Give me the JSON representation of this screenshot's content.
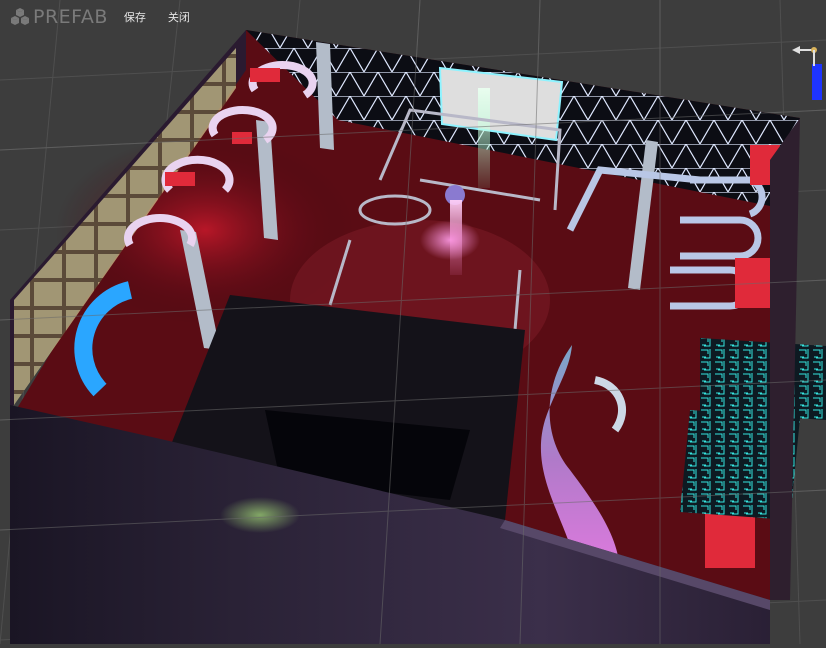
{
  "app": {
    "logo_text": "PREFAB",
    "logo_icon": "cubes-icon"
  },
  "toolbar": {
    "save_label": "保存",
    "close_label": "关闭"
  },
  "viewport": {
    "scene": "3d-nightclub-model",
    "background_color": "#3d3d3d",
    "grid_color": "#4a4a4a",
    "accent_colors": {
      "wall_lights": "#e6f0ff",
      "stair_glow": "#2aa6ff",
      "screen": "#dcdcdc",
      "floor_red": "#7a0d16",
      "neon_cyan": "#27e0d8",
      "sculpture_pink": "#e38ad8"
    }
  }
}
